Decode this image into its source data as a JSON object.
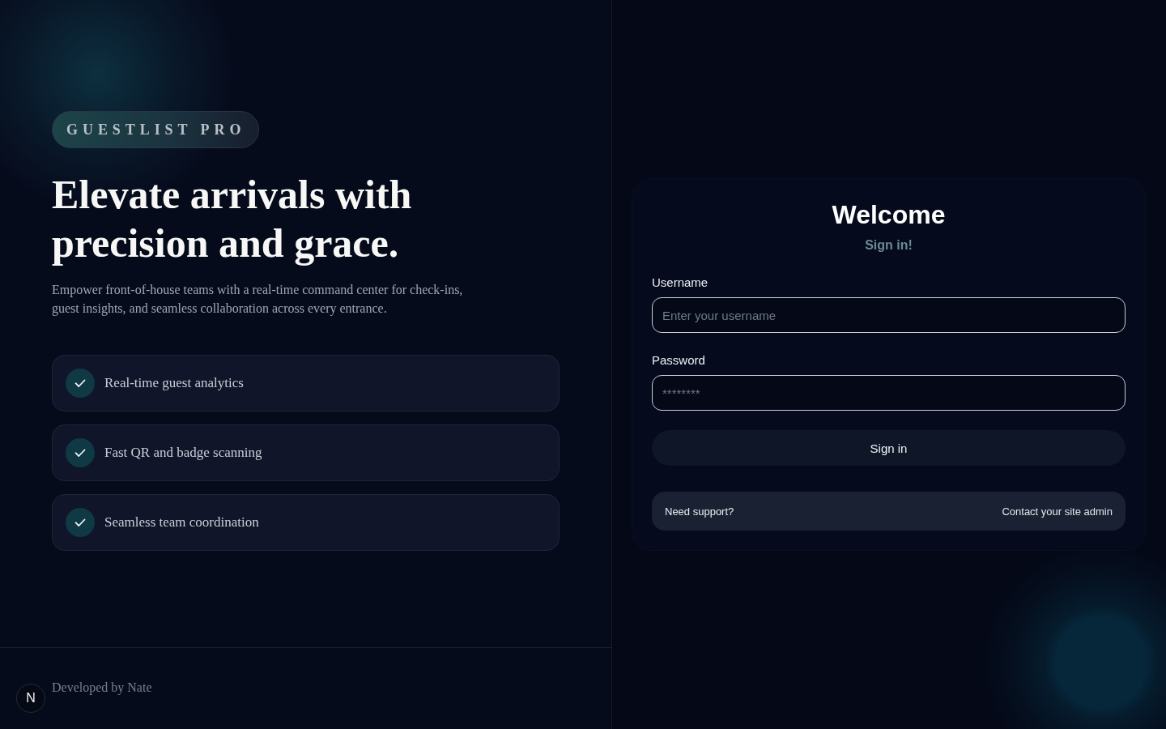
{
  "brand": {
    "badge": "GUESTLIST PRO"
  },
  "hero": {
    "headline": "Elevate arrivals with precision and grace.",
    "description": "Empower front-of-house teams with a real-time command center for check-ins, guest insights, and seamless collaboration across every entrance."
  },
  "features": [
    {
      "label": "Real-time guest analytics"
    },
    {
      "label": "Fast QR and badge scanning"
    },
    {
      "label": "Seamless team coordination"
    }
  ],
  "footer": {
    "credit": "Developed by Nate"
  },
  "corner_button": {
    "letter": "N"
  },
  "login": {
    "title": "Welcome",
    "subtitle": "Sign in!",
    "fields": [
      {
        "label": "Username",
        "placeholder": "Enter your username"
      },
      {
        "label": "Password",
        "placeholder": "********"
      }
    ],
    "submit": "Sign in",
    "support": {
      "prompt": "Need support?",
      "link": "Contact your site admin"
    }
  }
}
